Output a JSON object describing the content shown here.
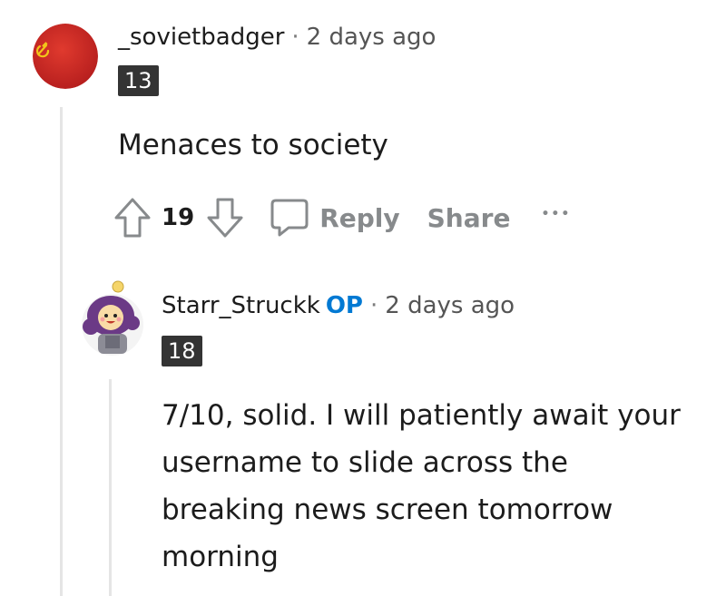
{
  "comments": [
    {
      "author": "_sovietbadger",
      "separator": "·",
      "timestamp": "2 days ago",
      "flair": "13",
      "body": "Menaces to society",
      "votes": "19",
      "reply_label": "Reply",
      "share_label": "Share",
      "more_label": "•••"
    },
    {
      "author": "Starr_Struckk",
      "op_tag": "OP",
      "separator": "·",
      "timestamp": "2 days ago",
      "flair": "18",
      "body_lines": [
        "7/10, solid. I will patiently await your",
        "username to slide across the",
        "breaking news screen tomorrow",
        "morning"
      ]
    }
  ],
  "colors": {
    "op_blue": "#0079d3",
    "action_gray": "#878a8c",
    "flair_bg": "#343434",
    "thread_line": "#e5e5e5"
  },
  "icons": [
    "hammer-sickle-avatar",
    "upvote-icon",
    "downvote-icon",
    "comment-bubble-icon",
    "cartoon-avatar"
  ]
}
